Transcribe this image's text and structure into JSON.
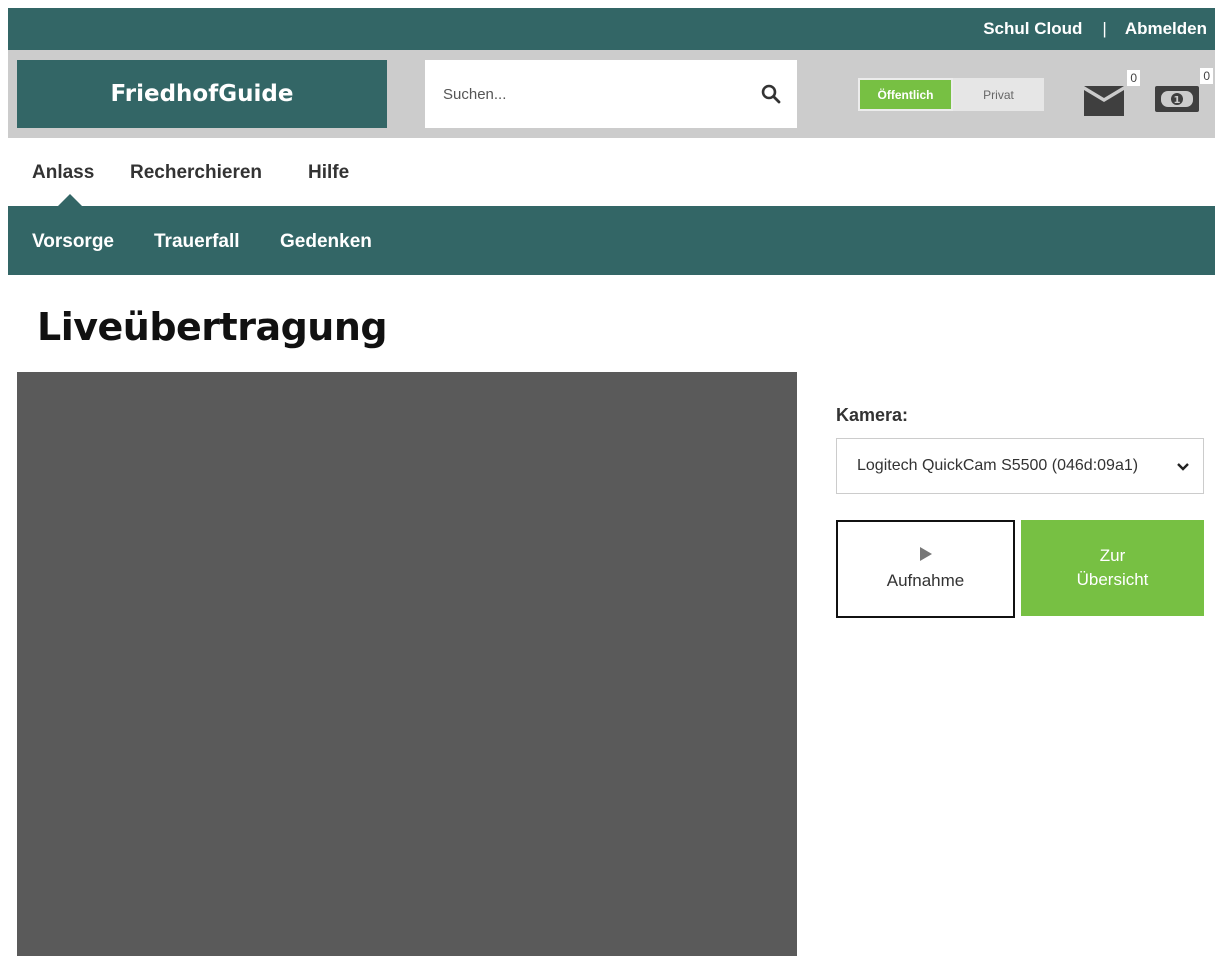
{
  "topbar": {
    "link1": "Schul Cloud",
    "separator": "|",
    "link2": "Abmelden"
  },
  "header": {
    "logo": "FriedhofGuide",
    "search_placeholder": "Suchen...",
    "toggle_public": "Öffentlich",
    "toggle_private": "Privat",
    "mail_count": "0",
    "money_count": "0",
    "icons": [
      "search-icon",
      "mail-icon",
      "money-icon"
    ]
  },
  "mainnav": {
    "items": [
      "Anlass",
      "Recherchieren",
      "Hilfe"
    ],
    "active": "Anlass"
  },
  "subnav": {
    "items": [
      "Vorsorge",
      "Trauerfall",
      "Gedenken"
    ]
  },
  "page": {
    "title": "Liveübertragung"
  },
  "camera": {
    "label": "Kamera:",
    "selected": "Logitech QuickCam S5500 (046d:09a1)"
  },
  "buttons": {
    "record": "Aufnahme",
    "overview_line1": "Zur",
    "overview_line2": "Übersicht"
  },
  "colors": {
    "primary": "#336666",
    "accent": "#77c043",
    "header_bg": "#cccccc",
    "video_bg": "#5a5a5a"
  }
}
